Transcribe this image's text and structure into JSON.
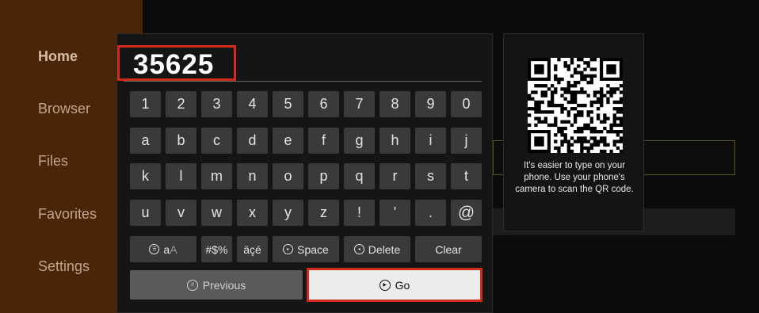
{
  "sidebar": {
    "items": [
      {
        "label": "Home"
      },
      {
        "label": "Browser"
      },
      {
        "label": "Files"
      },
      {
        "label": "Favorites"
      },
      {
        "label": "Settings"
      }
    ]
  },
  "colors": {
    "sidebar_bg": "#4a2508",
    "highlight_border": "#d22a1c",
    "key_bg": "#3a3a3a",
    "go_bg": "#ececec"
  },
  "keyboard": {
    "input_value": "35625",
    "rows": [
      [
        "1",
        "2",
        "3",
        "4",
        "5",
        "6",
        "7",
        "8",
        "9",
        "0"
      ],
      [
        "a",
        "b",
        "c",
        "d",
        "e",
        "f",
        "g",
        "h",
        "i",
        "j"
      ],
      [
        "k",
        "l",
        "m",
        "n",
        "o",
        "p",
        "q",
        "r",
        "s",
        "t"
      ],
      [
        "u",
        "v",
        "w",
        "x",
        "y",
        "z",
        "!",
        "'",
        ".",
        "@"
      ]
    ],
    "special_keys": {
      "case_a": "a",
      "case_A": "A",
      "symbols": "#$%",
      "accents": "äçé",
      "space": "Space",
      "delete": "Delete",
      "clear": "Clear"
    },
    "previous_label": "Previous",
    "go_label": "Go",
    "icons": [
      "case-toggle-icon",
      "space-icon",
      "delete-icon",
      "previous-icon",
      "go-icon"
    ]
  },
  "qr_panel": {
    "help_text": "It's easier to type on your phone. Use your phone's camera to scan the QR code."
  }
}
